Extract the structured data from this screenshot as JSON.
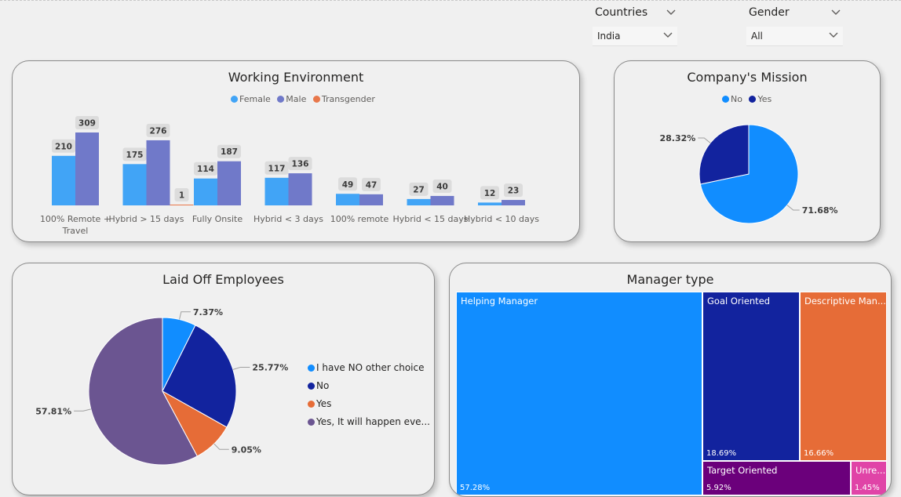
{
  "filters": {
    "countries": {
      "label": "Countries",
      "value": "India"
    },
    "gender": {
      "label": "Gender",
      "value": "All"
    }
  },
  "colors": {
    "female": "#41a4f6",
    "male": "#7079c9",
    "transgender": "#e8774a",
    "no": "#118dff",
    "yes": "#12239e",
    "laid_off": [
      "#118dff",
      "#12239e",
      "#e66c37",
      "#6b5591"
    ],
    "treemap": [
      "#118dff",
      "#12239e",
      "#e66c37",
      "#6b007b",
      "#e044a7"
    ]
  },
  "chart_data": [
    {
      "id": "working_environment",
      "type": "bar",
      "title": "Working Environment",
      "legend_position": "top-center",
      "categories": [
        "100% Remote + Travel",
        "Hybrid > 15 days",
        "Fully Onsite",
        "Hybrid < 3 days",
        "100% remote",
        "Hybrid < 15 days",
        "Hybrid < 10 days"
      ],
      "category_lines": [
        [
          "100% Remote +",
          "Travel"
        ],
        [
          "Hybrid > 15 days"
        ],
        [
          "Fully Onsite"
        ],
        [
          "Hybrid < 3 days"
        ],
        [
          "100% remote"
        ],
        [
          "Hybrid < 15 days"
        ],
        [
          "Hybrid < 10 days"
        ]
      ],
      "series": [
        {
          "name": "Female",
          "values": [
            210,
            175,
            114,
            117,
            49,
            27,
            12
          ]
        },
        {
          "name": "Male",
          "values": [
            309,
            276,
            187,
            136,
            47,
            40,
            23
          ]
        },
        {
          "name": "Transgender",
          "values": [
            null,
            1,
            null,
            null,
            null,
            null,
            null
          ]
        }
      ]
    },
    {
      "id": "company_mission",
      "type": "pie",
      "title": "Company's Mission",
      "legend_position": "top-center",
      "labels": [
        "No",
        "Yes"
      ],
      "values": [
        71.68,
        28.32
      ],
      "value_labels": [
        "71.68%",
        "28.32%"
      ]
    },
    {
      "id": "laid_off",
      "type": "pie",
      "title": "Laid Off Employees",
      "legend_position": "right",
      "labels": [
        "I have NO other choice",
        "No",
        "Yes",
        "Yes, It will happen eve..."
      ],
      "values": [
        7.37,
        25.77,
        9.05,
        57.81
      ],
      "value_labels": [
        "7.37%",
        "25.77%",
        "9.05%",
        "57.81%"
      ]
    },
    {
      "id": "manager_type",
      "type": "treemap",
      "title": "Manager type",
      "labels": [
        "Helping Manager",
        "Goal Oriented",
        "Descriptive Man...",
        "Target Oriented",
        "Unre..."
      ],
      "values": [
        57.28,
        18.69,
        16.66,
        5.92,
        1.45
      ],
      "value_labels": [
        "57.28%",
        "18.69%",
        "16.66%",
        "5.92%",
        "1.45%"
      ]
    }
  ]
}
